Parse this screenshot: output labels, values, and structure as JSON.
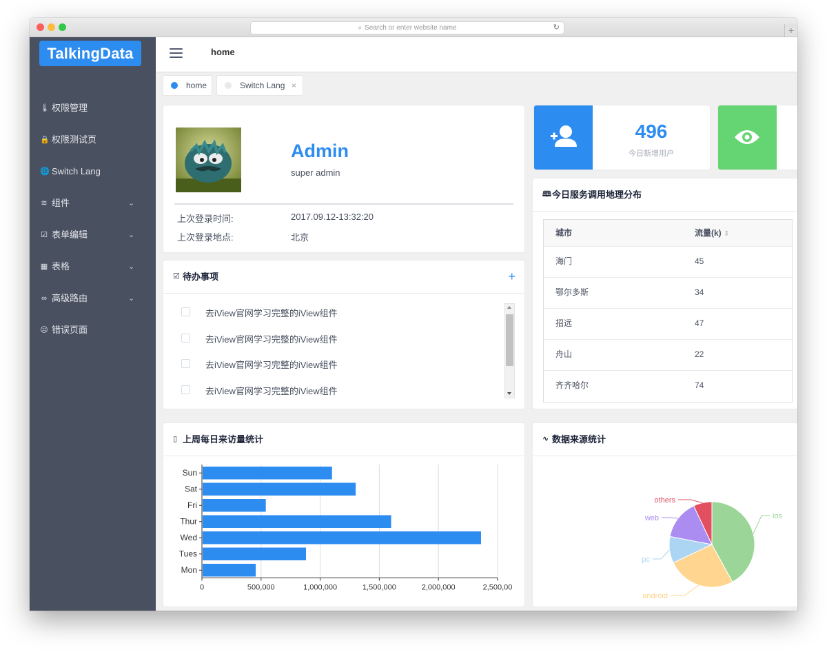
{
  "browser": {
    "address_placeholder": "Search or enter website name",
    "search_glyph": "⌕",
    "reload_glyph": "↻",
    "new_tab_glyph": "+"
  },
  "sidebar": {
    "logo": "TalkingData",
    "items": [
      {
        "label": "权限管理",
        "icon": "thermometer-icon",
        "glyph": "🌡",
        "has_arrow": false
      },
      {
        "label": "权限测试页",
        "icon": "lock-icon",
        "glyph": "🔒",
        "has_arrow": false
      },
      {
        "label": "Switch Lang",
        "icon": "globe-icon",
        "glyph": "🌐",
        "has_arrow": false
      },
      {
        "label": "组件",
        "icon": "layers-icon",
        "glyph": "≋",
        "has_arrow": true
      },
      {
        "label": "表单编辑",
        "icon": "checkbox-icon",
        "glyph": "☑",
        "has_arrow": true
      },
      {
        "label": "表格",
        "icon": "grid-icon",
        "glyph": "▦",
        "has_arrow": true
      },
      {
        "label": "高级路由",
        "icon": "infinity-icon",
        "glyph": "∞",
        "has_arrow": true
      },
      {
        "label": "错误页面",
        "icon": "sad-face-icon",
        "glyph": "☹",
        "has_arrow": false
      }
    ],
    "arrow_glyph": "⌄"
  },
  "header": {
    "title": "home"
  },
  "tags": [
    {
      "label": "home",
      "active": true
    },
    {
      "label": "Switch Lang",
      "active": false,
      "close": "×"
    }
  ],
  "profile": {
    "name": "Admin",
    "role": "super admin",
    "last_login_time_label": "上次登录时间:",
    "last_login_time": "2017.09.12-13:32:20",
    "last_login_place_label": "上次登录地点:",
    "last_login_place": "北京"
  },
  "stats": [
    {
      "value": "496",
      "label": "今日新增用户",
      "icon": "add-user-icon",
      "color": "#2d8cf0"
    },
    {
      "icon": "eye-icon",
      "color": "#64d572"
    }
  ],
  "todo": {
    "title": "待办事项",
    "icon": "todo-check-icon",
    "icon_glyph": "☑",
    "add": "+",
    "items": [
      "去iView官网学习完整的iView组件",
      "去iView官网学习完整的iView组件",
      "去iView官网学习完整的iView组件",
      "去iView官网学习完整的iView组件"
    ]
  },
  "geo": {
    "title": "今日服务调用地理分布",
    "icon": "map-icon",
    "icon_glyph": "🕮",
    "columns": [
      "城市",
      "流量(k)"
    ],
    "sort_glyph": "⇕",
    "rows": [
      {
        "city": "海门",
        "traffic": "45"
      },
      {
        "city": "鄂尔多斯",
        "traffic": "34"
      },
      {
        "city": "招远",
        "traffic": "47"
      },
      {
        "city": "舟山",
        "traffic": "22"
      },
      {
        "city": "齐齐哈尔",
        "traffic": "74"
      }
    ]
  },
  "visits": {
    "title": "上周每日来访量统计",
    "icon": "map-folded-icon",
    "icon_glyph": "▯"
  },
  "sources": {
    "title": "数据来源统计",
    "icon": "pulse-icon",
    "icon_glyph": "∿"
  },
  "chart_data": [
    {
      "type": "bar",
      "orientation": "horizontal",
      "categories": [
        "Mon",
        "Tues",
        "Wed",
        "Thur",
        "Fri",
        "Sat",
        "Sun"
      ],
      "values": [
        455000,
        880000,
        2360000,
        1600000,
        540000,
        1300000,
        1100000
      ],
      "xlim": [
        0,
        2500000
      ],
      "x_ticks": [
        "0",
        "500,000",
        "1,000,000",
        "1,500,000",
        "2,000,000",
        "2,500,00"
      ],
      "color": "#2d8cf0",
      "grid": true
    },
    {
      "type": "pie",
      "labels": [
        "ios",
        "android",
        "pc",
        "web",
        "others"
      ],
      "values": [
        42,
        26,
        10,
        15,
        7
      ],
      "colors": [
        "#9bd598",
        "#ffd58f",
        "#abd5f2",
        "#ab8df2",
        "#e14f60"
      ]
    }
  ]
}
